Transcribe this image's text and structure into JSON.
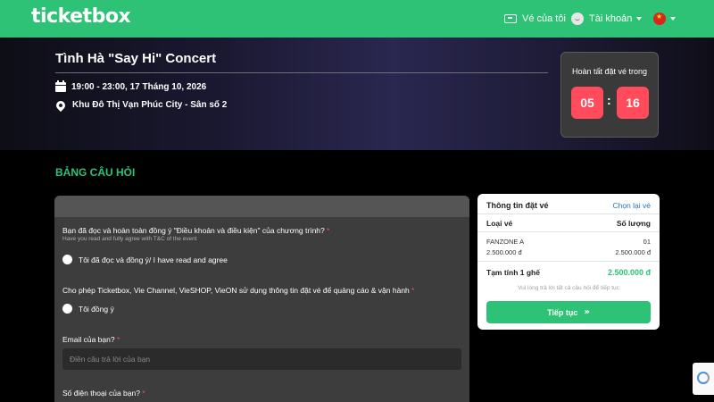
{
  "header": {
    "logo": "ticketbox",
    "my_tickets": "Vé của tôi",
    "account": "Tài khoản"
  },
  "event": {
    "title": "Tình Hà \"Say Hi\" Concert",
    "datetime": "19:00 - 23:00, 17 Tháng 10, 2026",
    "location": "Khu Đô Thị Vạn Phúc City - Sân số 2"
  },
  "timer": {
    "label": "Hoàn tất đặt vé trong",
    "minutes": "05",
    "colon": ":",
    "seconds": "16"
  },
  "form": {
    "section_title": "BẢNG CÂU HỎI",
    "q1": {
      "label": "Bạn đã đọc và hoàn toàn đồng ý \"Điều khoản và điều kiện\" của chương trình?",
      "sub": "Have you read and fully agree with T&C of the event",
      "option": "Tôi đã đọc và đồng ý/ I have read and agree"
    },
    "q2": {
      "label": "Cho phép Ticketbox, Vie Channel, VieSHOP, VieON sử dụng thông tin đặt vé để quảng cáo & vận hành",
      "option": "Tôi đồng ý"
    },
    "q3": {
      "label": "Email của bạn?",
      "placeholder": "Điền câu trả lời của bạn"
    },
    "q4": {
      "label": "Số điện thoại của bạn?"
    },
    "required_mark": "*"
  },
  "summary": {
    "title": "Thông tin đặt vé",
    "reselect": "Chọn lại vé",
    "col_type": "Loại vé",
    "col_qty": "Số lượng",
    "ticket_name": "FANZONE A",
    "ticket_qty": "01",
    "unit_price": "2.500.000 đ",
    "line_total": "2.500.000 đ",
    "subtotal_label": "Tạm tính 1 ghế",
    "subtotal_value": "2.500.000 đ",
    "hint": "Vui lòng trả lời tất cả câu hỏi để tiếp tục",
    "continue": "Tiếp tục"
  },
  "colors": {
    "brand_green": "#2dc275",
    "timer_red": "#ff4b5c",
    "link_blue": "#2a73b8"
  },
  "icons": [
    "ticket-icon",
    "account-icon",
    "vietnam-flag-icon",
    "calendar-icon",
    "location-pin-icon",
    "chevron-double-right-icon",
    "recaptcha-icon"
  ]
}
